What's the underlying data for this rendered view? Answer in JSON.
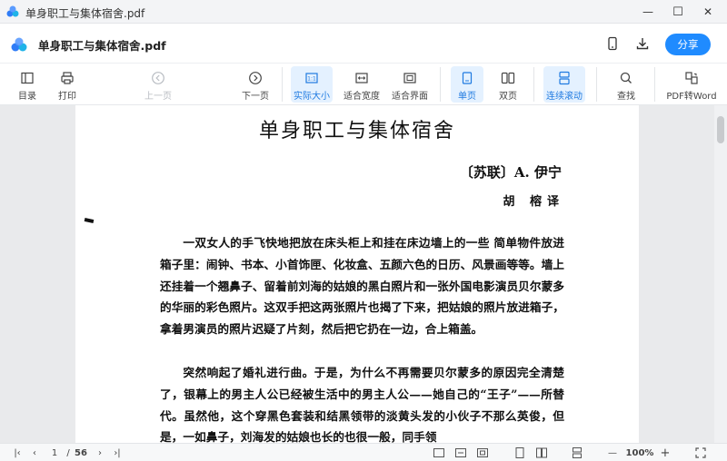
{
  "window": {
    "title": "单身职工与集体宿舍.pdf",
    "controls": {
      "minimize": "—",
      "maximize": "☐",
      "close": "✕"
    }
  },
  "header": {
    "file_name": "单身职工与集体宿舍.pdf",
    "share_label": "分享",
    "accent_color": "#1f8bff"
  },
  "toolbar": {
    "toc": "目录",
    "print": "打印",
    "prev_page": "上一页",
    "current_page": "1",
    "page_separator": "/",
    "total_pages": "56",
    "next_page": "下一页",
    "actual_size": "实际大小",
    "fit_width": "适合宽度",
    "fit_page": "适合界面",
    "single_page": "单页",
    "double_page": "双页",
    "continuous_scroll": "连续滚动",
    "search": "查找",
    "pdf_to_word": "PDF转Word"
  },
  "document": {
    "title": "单身职工与集体宿舍",
    "author": "〔苏联〕A. 伊宁",
    "translator": "胡  榕译",
    "paragraphs": [
      "一双女人的手飞快地把放在床头柜上和挂在床边墙上的一些 简单物件放进箱子里：闹钟、书本、小首饰匣、化妆盒、五颜六色的日历、风景画等等。墙上还挂着一个翘鼻子、留着前刘海的姑娘的黑白照片和一张外国电影演员贝尔蒙多的华丽的彩色照片。这双手把这两张照片也揭了下来，把姑娘的照片放进箱子，拿着男演员的照片迟疑了片刻，然后把它扔在一边，合上箱盖。",
      "突然响起了婚礼进行曲。于是，为什么不再需要贝尔蒙多的原因完全清楚了，银幕上的男主人公已经被生活中的男主人公——她自己的“王子”——所替代。虽然他，这个穿黑色套装和结黑领带的淡黄头发的小伙子不那么英俊，但是，一如鼻子，刘海发的姑娘也长的也很一般，同手领"
    ]
  },
  "statusbar": {
    "first_page": "|‹",
    "prev": "‹",
    "current_page": "1",
    "separator": "/",
    "total_pages": "56",
    "next": "›",
    "last_page": "›|",
    "zoom_out": "—",
    "zoom": "100%",
    "zoom_in": "+"
  }
}
